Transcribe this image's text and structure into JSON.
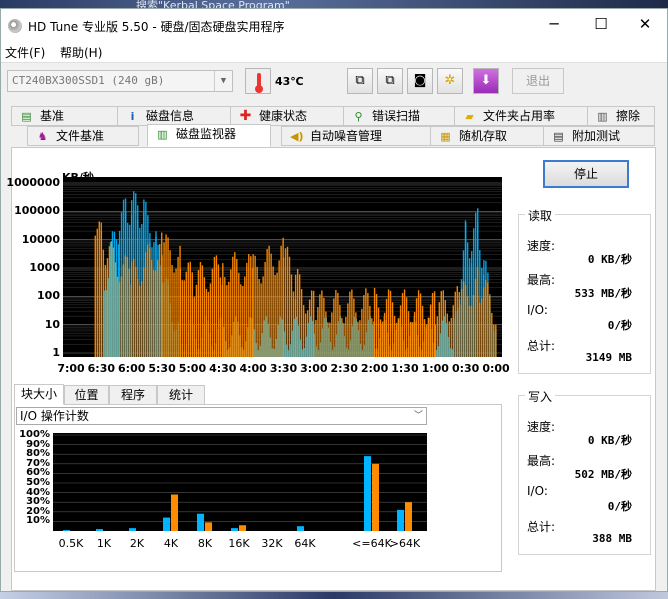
{
  "background_search": "搜索\"Kerbal Space Program\"",
  "window": {
    "title": "HD Tune 专业版 5.50 - 硬盘/固态硬盘实用程序",
    "minimize": "─",
    "maximize": "☐",
    "close": "✕"
  },
  "menu": {
    "file": "文件(F)",
    "help": "帮助(H)"
  },
  "toolbar": {
    "drive": "CT240BX300SSD1 (240 gB)",
    "temperature": "43℃",
    "exit": "退出"
  },
  "tabs_top": [
    {
      "label": "基准",
      "icon": "benchmark-icon"
    },
    {
      "label": "磁盘信息",
      "icon": "info-icon"
    },
    {
      "label": "健康状态",
      "icon": "health-cross-icon"
    },
    {
      "label": "错误扫描",
      "icon": "magnifier-icon"
    },
    {
      "label": "文件夹占用率",
      "icon": "folder-icon"
    },
    {
      "label": "擦除",
      "icon": "trash-icon"
    }
  ],
  "tabs_bottom": [
    {
      "label": "文件基准",
      "icon": "file-benchmark-icon"
    },
    {
      "label": "磁盘监视器",
      "icon": "monitor-chart-icon"
    },
    {
      "label": "自动噪音管理",
      "icon": "speaker-icon"
    },
    {
      "label": "随机存取",
      "icon": "random-access-icon"
    },
    {
      "label": "附加测试",
      "icon": "extra-tests-icon"
    }
  ],
  "monitor": {
    "unit": "KB/秒",
    "stop": "停止"
  },
  "read": {
    "title": "读取",
    "speed_label": "速度:",
    "speed": "0 KB/秒",
    "max_label": "最高:",
    "max": "533 MB/秒",
    "io_label": "I/O:",
    "io": "0/秒",
    "total_label": "总计:",
    "total": "3149 MB"
  },
  "write": {
    "title": "写入",
    "speed_label": "速度:",
    "speed": "0 KB/秒",
    "max_label": "最高:",
    "max": "502 MB/秒",
    "io_label": "I/O:",
    "io": "0/秒",
    "total_label": "总计:",
    "total": "388 MB"
  },
  "bottom_tabs": [
    "块大小",
    "位置",
    "程序",
    "统计"
  ],
  "io_select": "I/O 操作计数",
  "colors": {
    "read": "#00b4ff",
    "write": "#ff8c00",
    "graph_bg": "#000000"
  },
  "chart_data": [
    {
      "type": "area",
      "ylabel": "KB/秒",
      "yscale": "log",
      "ylim": [
        1,
        1000000
      ],
      "y_ticks": [
        "1000000",
        "100000",
        "10000",
        "1000",
        "100",
        "10",
        "1"
      ],
      "x_ticks": [
        "7:00",
        "6:30",
        "6:00",
        "5:30",
        "5:00",
        "4:30",
        "4:00",
        "3:30",
        "3:00",
        "2:30",
        "2:00",
        "1:30",
        "1:00",
        "0:30",
        "0:00"
      ],
      "xlim": [
        "7:00",
        "0:00"
      ],
      "series": [
        {
          "name": "读取",
          "color": "#00b4ff",
          "points": [
            [
              6.45,
              300
            ],
            [
              6.35,
              3000
            ],
            [
              6.2,
              30000
            ],
            [
              6.1,
              100000
            ],
            [
              6.0,
              150000
            ],
            [
              5.9,
              120000
            ],
            [
              5.8,
              80000
            ],
            [
              5.7,
              30000
            ],
            [
              5.6,
              5000
            ],
            [
              5.5,
              1000
            ],
            [
              5.4,
              100
            ],
            [
              5.2,
              5
            ],
            [
              0.7,
              5
            ],
            [
              0.5,
              20000
            ],
            [
              0.4,
              5000
            ],
            [
              0.3,
              50000
            ],
            [
              0.2,
              1000
            ],
            [
              0.1,
              100
            ],
            [
              0.0,
              5
            ]
          ]
        },
        {
          "name": "写入",
          "color": "#ff8c00",
          "points": [
            [
              6.6,
              40000
            ],
            [
              6.5,
              10000
            ],
            [
              6.4,
              3000
            ],
            [
              6.0,
              500
            ],
            [
              5.5,
              5000
            ],
            [
              5.2,
              2000
            ],
            [
              5.0,
              300
            ],
            [
              4.5,
              1000
            ],
            [
              4.0,
              800
            ],
            [
              3.5,
              3000
            ],
            [
              3.3,
              300
            ],
            [
              3.0,
              40
            ],
            [
              2.0,
              50
            ],
            [
              1.0,
              40
            ],
            [
              0.6,
              60
            ],
            [
              0.3,
              300
            ],
            [
              0.0,
              30
            ]
          ]
        }
      ]
    },
    {
      "type": "bar",
      "categories": [
        "0.5K",
        "1K",
        "2K",
        "4K",
        "8K",
        "16K",
        "32K",
        "64K",
        "<=64K",
        ">64K"
      ],
      "y_ticks": [
        "100%",
        "90%",
        "80%",
        "70%",
        "60%",
        "50%",
        "40%",
        "30%",
        "20%",
        "10%"
      ],
      "ylim": [
        0,
        100
      ],
      "series": [
        {
          "name": "读取",
          "color": "#00b4ff",
          "values": [
            1,
            2,
            3,
            14,
            18,
            3,
            0,
            5,
            78,
            22
          ]
        },
        {
          "name": "写入",
          "color": "#ff8c00",
          "values": [
            0,
            0,
            0,
            38,
            9,
            6,
            0,
            0,
            70,
            30
          ]
        }
      ]
    }
  ]
}
